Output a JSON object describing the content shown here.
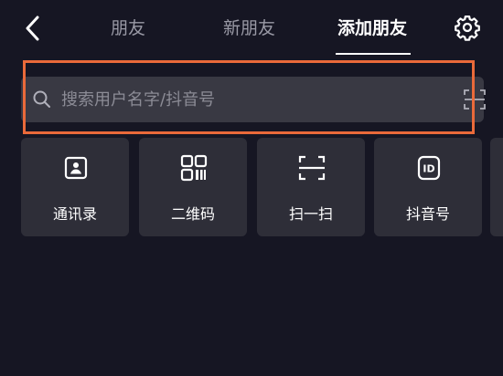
{
  "header": {
    "tabs": [
      {
        "label": "朋友",
        "active": false
      },
      {
        "label": "新朋友",
        "active": false
      },
      {
        "label": "添加朋友",
        "active": true
      }
    ],
    "back_icon": "chevron-left-icon",
    "settings_icon": "gear-icon"
  },
  "search": {
    "placeholder": "搜索用户名字/抖音号",
    "value": "",
    "scan_icon": "scan-icon"
  },
  "actions": [
    {
      "label": "通讯录",
      "icon": "contacts-icon"
    },
    {
      "label": "二维码",
      "icon": "qr-code-icon"
    },
    {
      "label": "扫一扫",
      "icon": "scan-icon"
    },
    {
      "label": "抖音号",
      "icon": "id-badge-icon"
    }
  ],
  "colors": {
    "background": "#161623",
    "card": "#2e2e38",
    "search_bg": "#393943",
    "highlight": "#ea6a3a",
    "inactive_tab": "#9a9aa6"
  }
}
